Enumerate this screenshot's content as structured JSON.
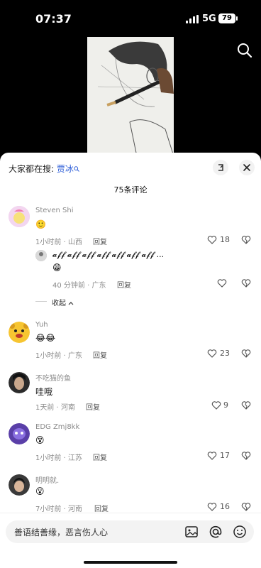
{
  "status_bar": {
    "time": "07:37",
    "network": "5G",
    "battery": "79"
  },
  "sheet": {
    "suggest_prefix": "大家都在搜:",
    "suggest_keyword": "贾冰",
    "comment_count": "75条评论"
  },
  "comments": [
    {
      "username": "Steven Shi",
      "emoji": "🙂",
      "time": "1小时前 · 山西",
      "reply": "回复",
      "likes": "18"
    },
    {
      "text": "𝓪𝓯𝓯 𝓪𝓯𝓯 𝓪𝓯𝓯 𝓪𝓯𝓯 𝓪𝓯𝓯 𝓪𝓯𝓯 𝓪𝓯𝓯 ...",
      "emoji": "😁",
      "time": "40 分钟前 · 广东",
      "reply": "回复"
    },
    {
      "username": "Yuh",
      "emoji": "😂😂",
      "time": "1小时前 · 广东",
      "reply": "回复",
      "likes": "23"
    },
    {
      "username": "不吃猫的鱼",
      "text": "哇哦",
      "time": "1天前 · 河南",
      "reply": "回复",
      "likes": "9"
    },
    {
      "username": "EDG Zmj8kk",
      "emoji": "😵",
      "time": "1小时前 · 江苏",
      "reply": "回复",
      "likes": "17"
    },
    {
      "username": "明明就.",
      "emoji": "😮",
      "time": "7小时前 · 河南",
      "reply": "回复",
      "likes": "16"
    }
  ],
  "collapse_label": "收起",
  "input": {
    "placeholder": "善语结善缘，恶言伤人心"
  },
  "colors": {
    "link": "#2a5bd7",
    "sheet_bg": "#ffffff",
    "meta": "#8a8a8a"
  }
}
